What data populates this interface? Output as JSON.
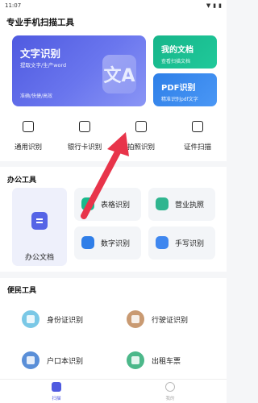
{
  "status_bar": {
    "time": "11:07",
    "icons": [
      "▼",
      "▮",
      "▮"
    ]
  },
  "header": {
    "title": "专业手机扫描工具"
  },
  "hero": {
    "main": {
      "title": "文字识别",
      "subtitle": "提取文字/生产word",
      "footer": "准确/快捷/高效",
      "glyph": "文A"
    },
    "my_docs": {
      "title": "我的文档",
      "subtitle": "查看扫描文档"
    },
    "pdf": {
      "title": "PDF识别",
      "subtitle": "精准识别pdf文字"
    }
  },
  "quick": [
    {
      "label": "通用识别",
      "icon": "camera-icon"
    },
    {
      "label": "银行卡识别",
      "icon": "bank-card-icon"
    },
    {
      "label": "拍照识别",
      "icon": "document-scan-icon"
    },
    {
      "label": "证件扫描",
      "icon": "id-card-icon"
    }
  ],
  "office": {
    "title": "办公工具",
    "big": {
      "label": "办公文档",
      "icon": "office-document-icon",
      "color": "#5564e6"
    },
    "tiles": [
      {
        "label": "表格识别",
        "icon": "table-icon",
        "color": "#19b98c"
      },
      {
        "label": "营业执照",
        "icon": "business-license-icon",
        "color": "#2fb58f"
      },
      {
        "label": "数字识别",
        "icon": "number-icon",
        "color": "#2f7ee8"
      },
      {
        "label": "手写识别",
        "icon": "handwriting-icon",
        "color": "#3f87ef"
      }
    ]
  },
  "convenience": {
    "title": "便民工具",
    "items": [
      {
        "label": "身份证识别",
        "icon": "id-card-icon",
        "color": "#e6f5fb"
      },
      {
        "label": "行驶证识别",
        "icon": "car-icon",
        "color": "#f7ebe1"
      },
      {
        "label": "户口本识别",
        "icon": "household-book-icon",
        "color": "#e8f2fd"
      },
      {
        "label": "出租车票",
        "icon": "taxi-ticket-icon",
        "color": "#e7f6ef"
      }
    ]
  },
  "tabbar": [
    {
      "label": "扫描",
      "icon": "scan-icon",
      "active": true
    },
    {
      "label": "我的",
      "icon": "profile-icon",
      "active": false
    }
  ],
  "colors": {
    "primary": "#4f5ae0",
    "green": "#16b58a",
    "blue": "#2e7fe8",
    "arrow": "#e8344a"
  }
}
